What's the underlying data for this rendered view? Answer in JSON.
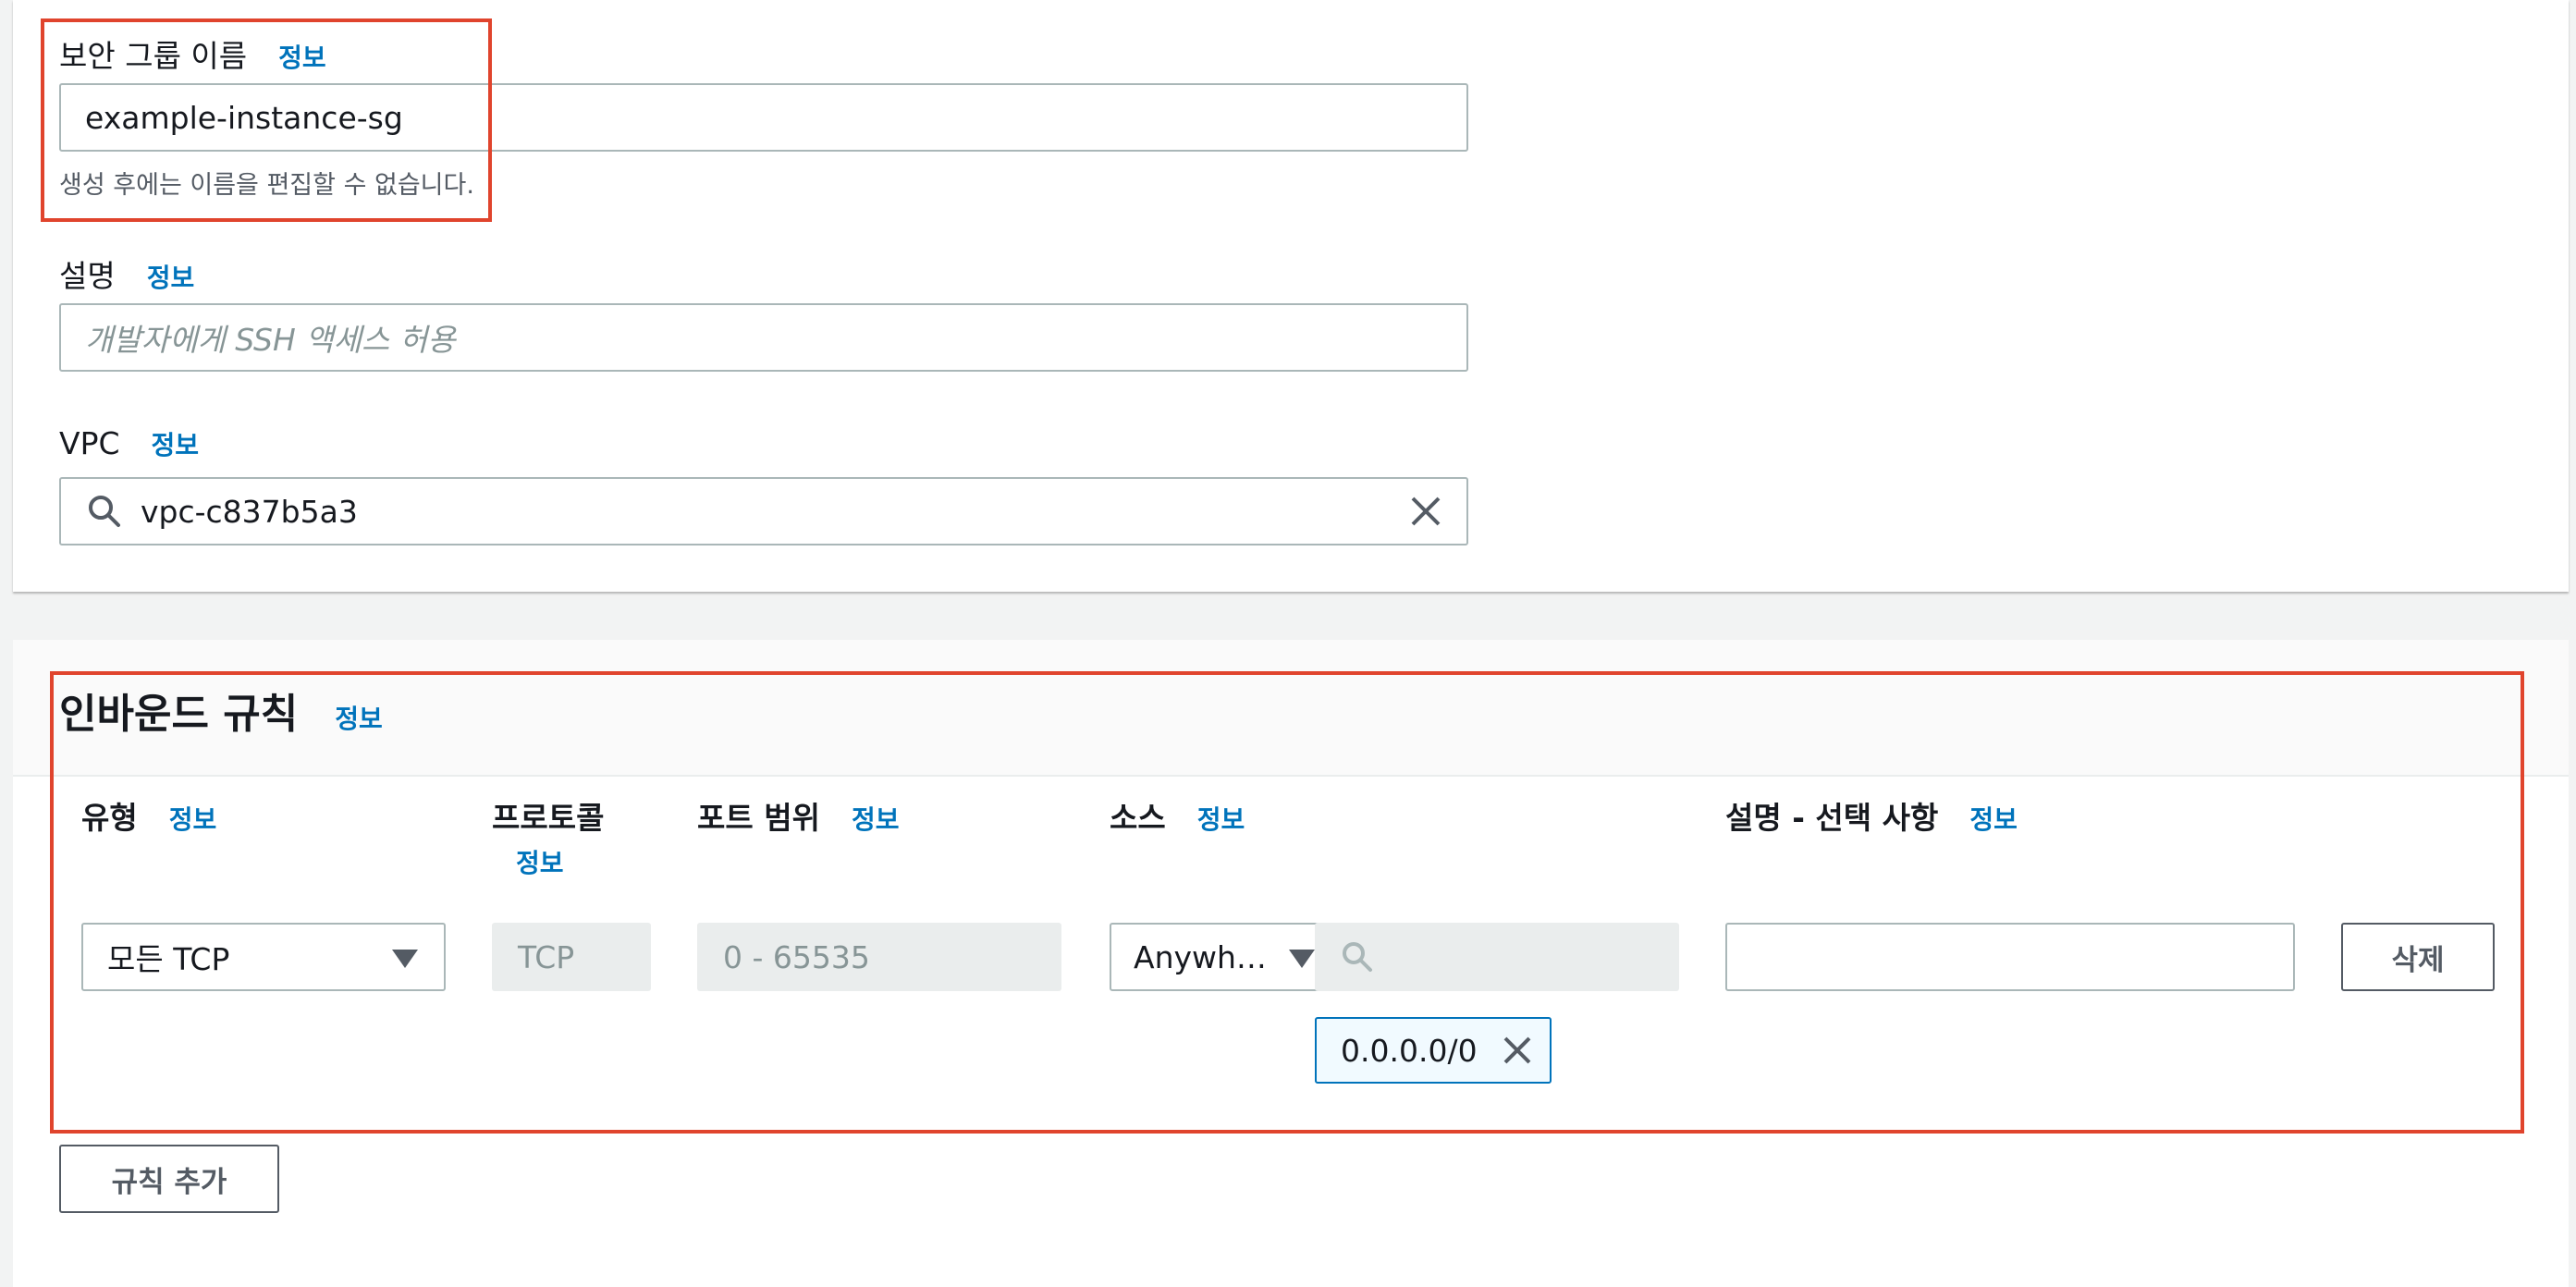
{
  "info_label": "정보",
  "sg_name": {
    "label": "보안 그룹 이름",
    "value": "example-instance-sg",
    "hint": "생성 후에는 이름을 편집할 수 없습니다."
  },
  "description": {
    "label": "설명",
    "placeholder": "개발자에게 SSH 액세스 허용"
  },
  "vpc": {
    "label": "VPC",
    "value": "vpc-c837b5a3"
  },
  "inbound": {
    "title": "인바운드 규칙",
    "columns": {
      "type": "유형",
      "protocol": "프로토콜",
      "port_range": "포트 범위",
      "source": "소스",
      "description": "설명 - 선택 사항"
    },
    "rule": {
      "type": "모든 TCP",
      "protocol": "TCP",
      "port_range": "0 - 65535",
      "source_type": "Anywh…",
      "source_cidr": "0.0.0.0/0",
      "description": ""
    },
    "delete_label": "삭제",
    "add_rule_label": "규칙 추가"
  },
  "colors": {
    "info_link": "#0073bb",
    "highlight": "#e0442d",
    "token_border": "#0073bb"
  }
}
